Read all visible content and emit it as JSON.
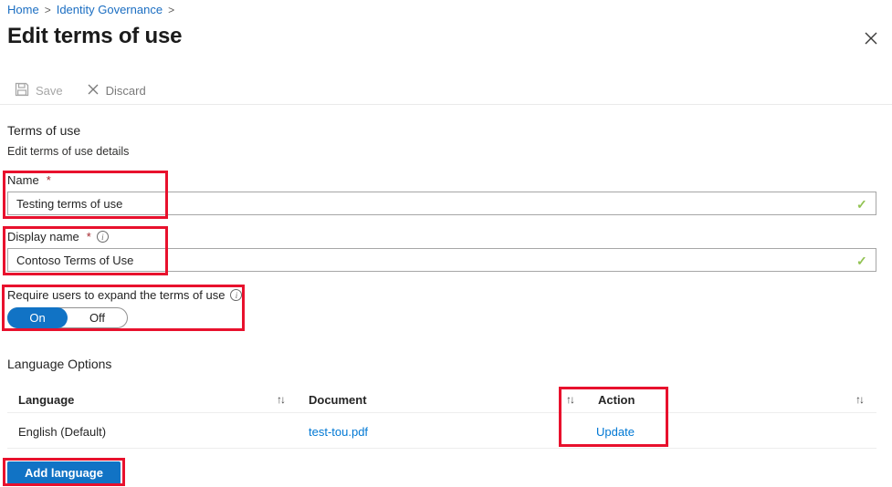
{
  "breadcrumb": {
    "items": [
      {
        "label": "Home"
      },
      {
        "label": "Identity Governance"
      }
    ],
    "separator": ">"
  },
  "page": {
    "title": "Edit terms of use"
  },
  "toolbar": {
    "save_label": "Save",
    "discard_label": "Discard"
  },
  "form": {
    "section_title": "Terms of use",
    "section_subtitle": "Edit terms of use details",
    "name_field": {
      "label": "Name",
      "required_marker": "*",
      "value": "Testing terms of use"
    },
    "display_name_field": {
      "label": "Display name",
      "required_marker": "*",
      "value": "Contoso Terms of Use"
    },
    "expand_toggle": {
      "label": "Require users to expand the terms of use",
      "on_label": "On",
      "off_label": "Off",
      "value": "On"
    }
  },
  "language_options": {
    "heading": "Language Options",
    "table": {
      "columns": {
        "language": "Language",
        "document": "Document",
        "action": "Action"
      },
      "rows": [
        {
          "language": "English (Default)",
          "document": "test-tou.pdf",
          "action": "Update"
        }
      ]
    },
    "add_button_label": "Add language"
  },
  "icons": {
    "valid_check": "✓",
    "sort": "↑↓",
    "info": "i"
  },
  "colors": {
    "accent_blue": "#1173c5",
    "link_blue": "#0078d4",
    "annotation_red": "#e8112d",
    "valid_green": "#92c353"
  }
}
